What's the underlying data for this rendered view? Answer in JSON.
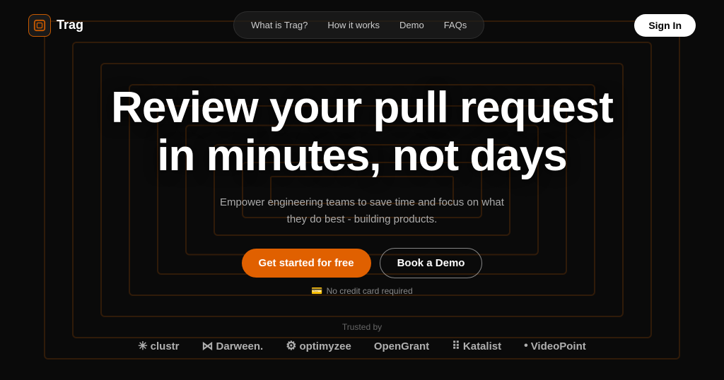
{
  "brand": {
    "name": "Trag"
  },
  "navbar": {
    "links": [
      {
        "label": "What is Trag?",
        "id": "what-is-trag"
      },
      {
        "label": "How it works",
        "id": "how-it-works"
      },
      {
        "label": "Demo",
        "id": "demo"
      },
      {
        "label": "FAQs",
        "id": "faqs"
      }
    ],
    "sign_in_label": "Sign In"
  },
  "hero": {
    "title_line1": "Review your pull request",
    "title_line2": "in minutes, not days",
    "subtitle": "Empower engineering teams to save time and focus on what they do best - building products.",
    "cta_primary": "Get started for free",
    "cta_secondary": "Book a Demo",
    "no_cc_text": "No credit card required"
  },
  "trusted": {
    "label": "Trusted by",
    "logos": [
      {
        "symbol": "✳",
        "name": "clustr"
      },
      {
        "symbol": "⋈",
        "name": "Darween."
      },
      {
        "symbol": "🔧",
        "name": "optimyzee"
      },
      {
        "symbol": "",
        "name": "OpenGrant"
      },
      {
        "symbol": "⠿",
        "name": "Katalist"
      },
      {
        "symbol": "•",
        "name": "VideoPoint"
      }
    ]
  },
  "colors": {
    "primary_orange": "#e06000",
    "background": "#0a0a0a",
    "spiral_color": "rgba(120,60,10,0.35)"
  }
}
